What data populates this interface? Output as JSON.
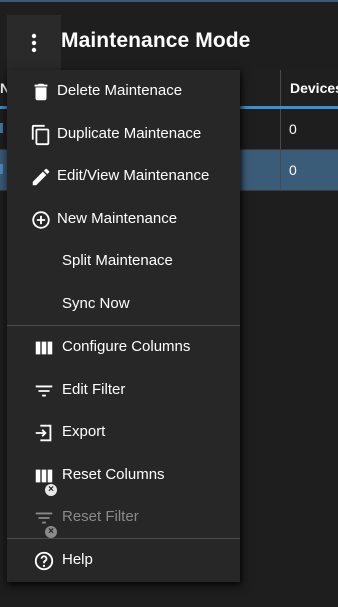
{
  "page": {
    "title": "Maintenance Mode"
  },
  "table": {
    "columns": {
      "first": "N",
      "devices": "Devices"
    },
    "rows": [
      {
        "devices": "0",
        "selected": false
      },
      {
        "devices": "0",
        "selected": true
      }
    ]
  },
  "menu": {
    "items": [
      {
        "label": "Delete Maintenace",
        "icon": "trash-icon",
        "enabled": true
      },
      {
        "label": "Duplicate Maintenace",
        "icon": "copy-icon",
        "enabled": true
      },
      {
        "label": "Edit/View Maintenance",
        "icon": "pencil-icon",
        "enabled": true
      },
      {
        "label": "New Maintenance",
        "icon": "plus-circle-icon",
        "enabled": true
      },
      {
        "label": "Split Maintenace",
        "icon": "",
        "enabled": true
      },
      {
        "label": "Sync Now",
        "icon": "",
        "enabled": true
      },
      {
        "label": "Configure Columns",
        "icon": "columns-icon",
        "enabled": true
      },
      {
        "label": "Edit Filter",
        "icon": "filter-icon",
        "enabled": true
      },
      {
        "label": "Export",
        "icon": "export-icon",
        "enabled": true
      },
      {
        "label": "Reset Columns",
        "icon": "columns-reset-icon",
        "enabled": true
      },
      {
        "label": "Reset Filter",
        "icon": "filter-reset-icon",
        "enabled": false
      },
      {
        "label": "Help",
        "icon": "help-circle-icon",
        "enabled": true
      }
    ]
  },
  "colors": {
    "background": "#1e1e1e",
    "menu_background": "#272727",
    "selected_row": "#3b5c79",
    "header_underline": "#3d8fd1",
    "disabled_text": "#8a8a8a"
  }
}
